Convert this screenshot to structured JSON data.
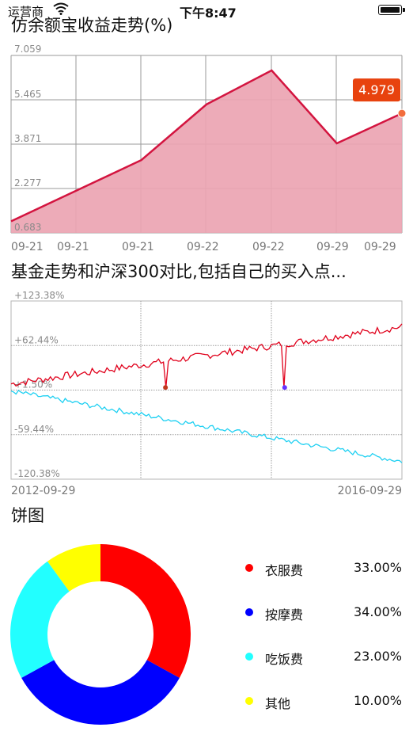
{
  "status_bar": {
    "carrier": "运营商",
    "time": "下午8:47"
  },
  "charts": {
    "area_title": "仿余额宝收益走势(%)",
    "compare_title": "基金走势和沪深300对比,包括自己的买入点...",
    "pie_title": "饼图"
  },
  "chart_data": [
    {
      "type": "area",
      "title": "仿余额宝收益走势(%)",
      "y_ticks": [
        "7.059",
        "5.465",
        "3.871",
        "2.277",
        "0.683"
      ],
      "ylim": [
        0.683,
        7.059
      ],
      "x_tick_labels": [
        "09-21",
        "09-21",
        "09-21",
        "09-22",
        "09-22",
        "09-29",
        "09-29"
      ],
      "values": [
        1.1,
        2.2,
        3.3,
        5.3,
        6.52,
        3.9,
        4.979
      ],
      "highlight": {
        "label": "4.979",
        "index": 6
      },
      "colors": {
        "line": "#d3143f",
        "fill": "#eca4b2",
        "marker": "#f26d3d",
        "tooltip": "#e8420e"
      },
      "grid": true
    },
    {
      "type": "line",
      "title": "基金走势和沪深300对比,包括自己的买入点...",
      "y_ticks": [
        "+123.38%",
        "+62.44%",
        "+1.50%",
        "-59.44%",
        "-120.38%"
      ],
      "ylim": [
        -120.38,
        123.38
      ],
      "x_range_labels": [
        "2012-09-29",
        "2016-09-29"
      ],
      "series": [
        {
          "color": "#e0001b",
          "start": 10,
          "end": 88,
          "noise": 5
        },
        {
          "color": "#1ed0f2",
          "start": 0,
          "end": -96,
          "noise": 3.5
        }
      ],
      "buy_points": [
        {
          "position": 0.395,
          "value": 5,
          "color": "#c0391f"
        },
        {
          "position": 0.7,
          "value": 5,
          "color": "#6633ff"
        }
      ],
      "grid": "dashed"
    },
    {
      "type": "pie",
      "title": "饼图",
      "slices": [
        {
          "label": "衣服费",
          "value": 33.0,
          "display": "33.00%",
          "color": "#ff0000"
        },
        {
          "label": "按摩费",
          "value": 34.0,
          "display": "34.00%",
          "color": "#0000ff"
        },
        {
          "label": "吃饭费",
          "value": 23.0,
          "display": "23.00%",
          "color": "#22ffff"
        },
        {
          "label": "其他",
          "value": 10.0,
          "display": "10.00%",
          "color": "#ffff00"
        }
      ],
      "donut": true
    }
  ]
}
